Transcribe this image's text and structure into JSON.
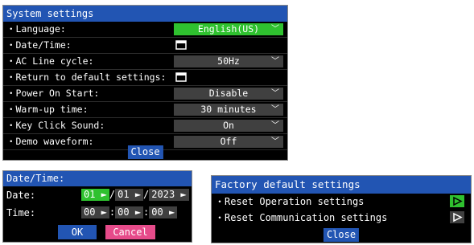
{
  "system_settings": {
    "title": "System settings",
    "rows": [
      {
        "label": "・Language:",
        "value": "English(US)",
        "kind": "select",
        "active": true
      },
      {
        "label": "・Date/Time:",
        "kind": "icon",
        "icon": "window-icon"
      },
      {
        "label": "・AC Line cycle:",
        "value": "50Hz",
        "kind": "select"
      },
      {
        "label": "・Return to default settings:",
        "kind": "icon",
        "icon": "window-icon"
      },
      {
        "label": "・Power On Start:",
        "value": "Disable",
        "kind": "select"
      },
      {
        "label": "・Warm-up time:",
        "value": "30 minutes",
        "kind": "select"
      },
      {
        "label": "・Key Click Sound:",
        "value": "On",
        "kind": "select"
      },
      {
        "label": "・Demo waveform:",
        "value": "Off",
        "kind": "select"
      }
    ],
    "close_label": "Close"
  },
  "date_time": {
    "title": "Date/Time:",
    "date_label": "Date:",
    "time_label": "Time:",
    "date_month": "01",
    "date_day": "01",
    "date_year": "2023",
    "date_sep": "/",
    "time_hour": "00",
    "time_minute": "00",
    "time_second": "00",
    "time_sep": ":",
    "ok_label": "OK",
    "cancel_label": "Cancel"
  },
  "factory_default": {
    "title": "Factory default settings",
    "rows": [
      {
        "label": "・Reset Operation settings",
        "active": true
      },
      {
        "label": "・Reset Communication settings",
        "active": false
      }
    ],
    "close_label": "Close"
  },
  "colors": {
    "titlebar": "#2255b3",
    "active_green": "#2fc12f",
    "field_gray": "#404040",
    "cancel_pink": "#e64b8a",
    "panel_bg": "#000000"
  }
}
